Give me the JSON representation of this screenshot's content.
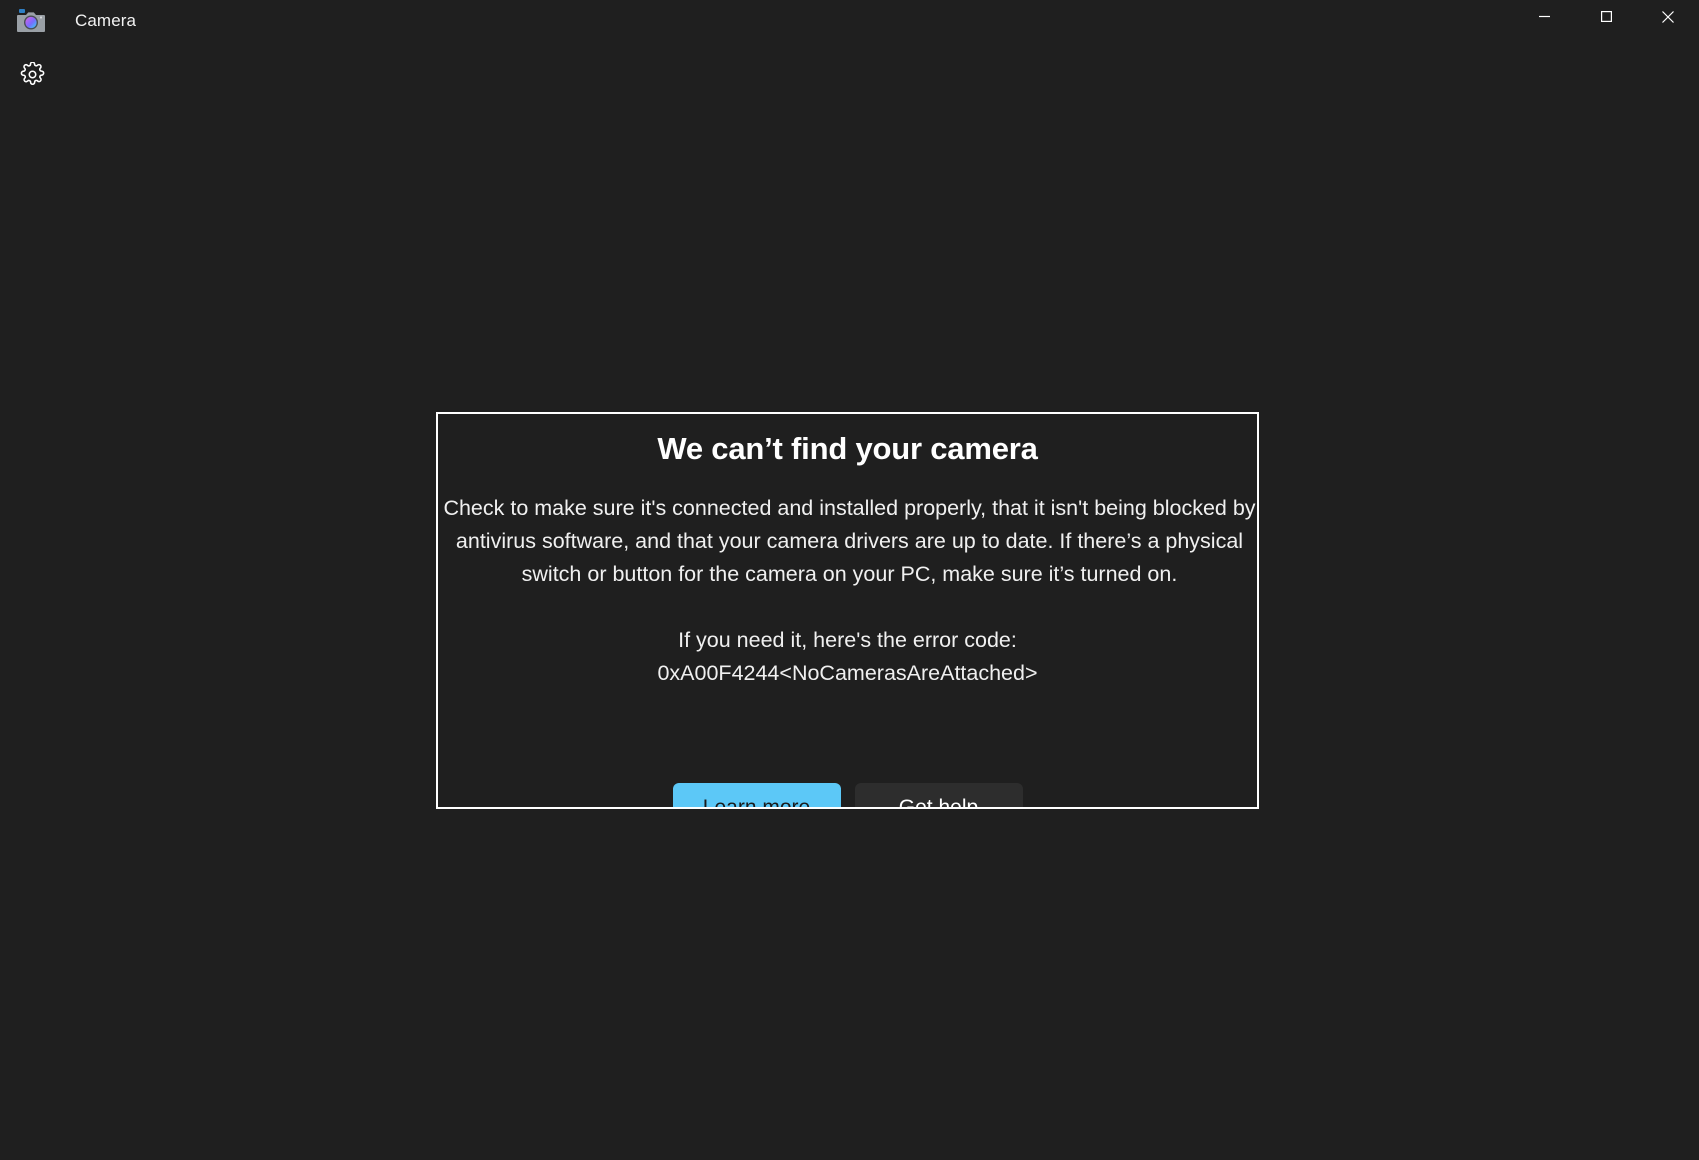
{
  "window": {
    "app_name": "Camera",
    "app_icon": "camera-icon",
    "controls": {
      "minimize_label": "Minimize",
      "maximize_label": "Maximize",
      "close_label": "Close"
    }
  },
  "toolbar": {
    "settings_label": "Settings",
    "settings_icon": "gear-icon"
  },
  "dialog": {
    "heading": "We can’t find your camera",
    "body": "Check to make sure it's connected and installed properly, that it isn't being blocked by antivirus software, and that your camera drivers are up to date. If there’s a physical switch or button for the camera on your PC, make sure it’s turned on.",
    "error_intro": "If you need it, here's the error code:",
    "error_code": "0xA00F4244<NoCamerasAreAttached>",
    "primary_button": "Learn more",
    "secondary_button": "Get help"
  },
  "colors": {
    "background": "#1f1f1f",
    "dialog_border": "#ffffff",
    "accent": "#5cc8f7",
    "secondary_button": "#2d2d2d",
    "text": "#ffffff"
  }
}
